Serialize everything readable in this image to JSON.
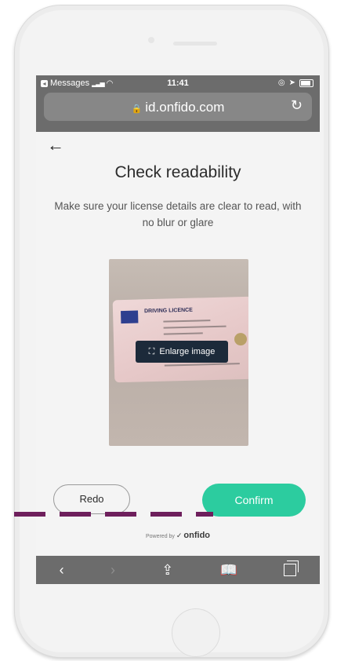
{
  "status_bar": {
    "back_app": "Messages",
    "time": "11:41"
  },
  "browser": {
    "url": "id.onfido.com"
  },
  "page": {
    "title": "Check readability",
    "subtitle": "Make sure your license details are clear to read, with no blur or glare",
    "licence_label": "DRIVING LICENCE",
    "enlarge_label": "Enlarge image",
    "redo_label": "Redo",
    "confirm_label": "Confirm",
    "powered_by": "Powered by",
    "brand": "onfido"
  },
  "colors": {
    "confirm": "#2ccc9f",
    "toolbar": "#6c6c6c",
    "annotation_dash": "#6e1f5c"
  },
  "icons": [
    "back-app-icon",
    "signal-icon",
    "wifi-icon",
    "battery-icon",
    "lock-icon",
    "reload-icon",
    "back-arrow-icon",
    "expand-icon",
    "share-icon",
    "bookmarks-icon",
    "tabs-icon"
  ]
}
